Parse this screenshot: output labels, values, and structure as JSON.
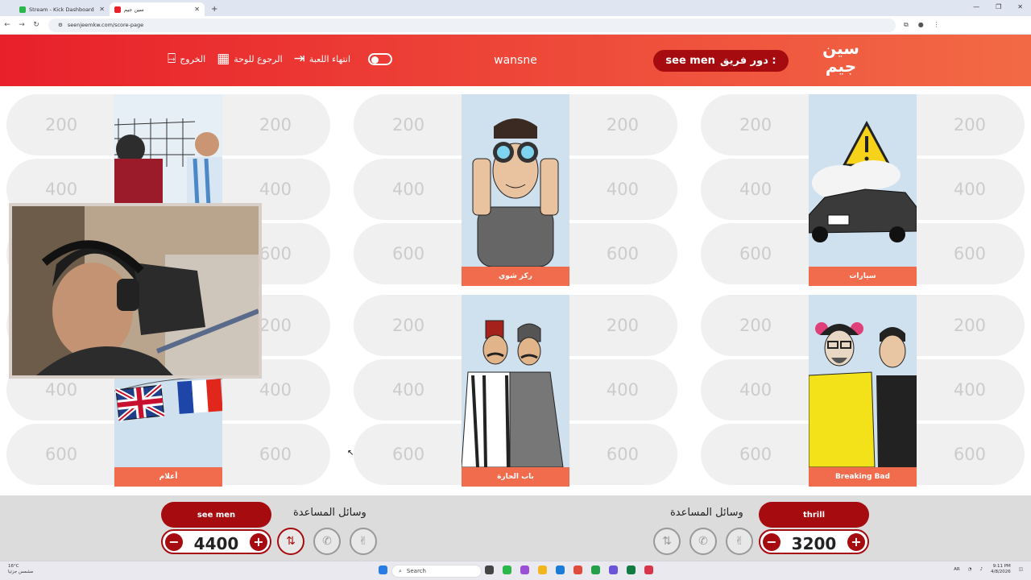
{
  "browser": {
    "tabs": [
      {
        "title": "Stream - Kick Dashboard",
        "active": false,
        "icon_color": "#2bb84a"
      },
      {
        "title": "سين جيم",
        "active": true,
        "icon_color": "#e8202a"
      }
    ],
    "url": "seenjeemkw.com/score-page"
  },
  "header": {
    "logo_text_1": "سين",
    "logo_text_2": "جيم",
    "turn_label": "دور فريق :",
    "turn_team": "see men",
    "game_name": "wansne",
    "end_game_label": "انتهاء اللعبة",
    "back_to_board_label": "الرجوع للوحة",
    "exit_label": "الخروج"
  },
  "categories": [
    {
      "label": "",
      "values": [
        "200",
        "400",
        "600"
      ],
      "art": "football"
    },
    {
      "label": "ركز شوي",
      "values": [
        "200",
        "400",
        "600"
      ],
      "art": "binoculars"
    },
    {
      "label": "سيارات",
      "values": [
        "200",
        "400",
        "600"
      ],
      "art": "cars"
    },
    {
      "label": "أعلام",
      "values": [
        "200",
        "400",
        "600"
      ],
      "art": "flags"
    },
    {
      "label": "باب الحارة",
      "values": [
        "200",
        "400",
        "600"
      ],
      "art": "bab"
    },
    {
      "label": "Breaking Bad",
      "values": [
        "200",
        "400",
        "600"
      ],
      "art": "breakingbad"
    }
  ],
  "teams": {
    "left": {
      "name": "see men",
      "score": "4400",
      "aids_label": "وسائل المساعدة"
    },
    "right": {
      "name": "thrill",
      "score": "3200",
      "aids_label": "وسائل المساعدة"
    }
  },
  "taskbar": {
    "weather_temp": "16°C",
    "weather_desc": "مشمس جزئيا",
    "search_label": "Search",
    "lang": "AR",
    "time": "9:11 PM",
    "date": "4/8/2026"
  },
  "colors": {
    "accent": "#e8202a",
    "dark_red": "#a50b0f",
    "card_label": "#f06c4d"
  }
}
